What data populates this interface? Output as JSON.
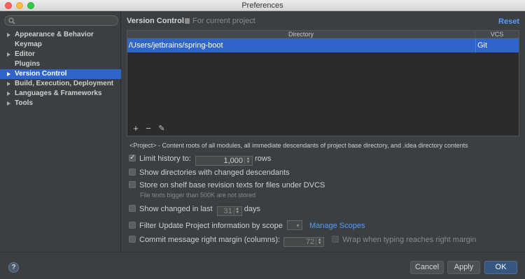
{
  "window": {
    "title": "Preferences"
  },
  "sidebar": {
    "search_placeholder": "",
    "items": [
      {
        "label": "Appearance & Behavior",
        "expandable": true,
        "selected": false
      },
      {
        "label": "Keymap",
        "expandable": false,
        "selected": false
      },
      {
        "label": "Editor",
        "expandable": true,
        "selected": false
      },
      {
        "label": "Plugins",
        "expandable": false,
        "selected": false
      },
      {
        "label": "Version Control",
        "expandable": true,
        "selected": true
      },
      {
        "label": "Build, Execution, Deployment",
        "expandable": true,
        "selected": false
      },
      {
        "label": "Languages & Frameworks",
        "expandable": true,
        "selected": false
      },
      {
        "label": "Tools",
        "expandable": true,
        "selected": false
      }
    ]
  },
  "main": {
    "heading": "Version Control",
    "scope": "For current project",
    "reset_label": "Reset",
    "table": {
      "columns": [
        "Directory",
        "VCS"
      ],
      "rows": [
        {
          "directory": "/Users/jetbrains/spring-boot",
          "vcs": "Git"
        }
      ]
    },
    "toolbar": {
      "add": "+",
      "remove": "−",
      "edit": "✎"
    },
    "description": "<Project> - Content roots of all modules, all immediate descendants of project base directory, and .idea directory contents",
    "options": {
      "limit_history": {
        "label": "Limit history to:",
        "checked": true,
        "value": "1,000",
        "suffix": "rows"
      },
      "show_dirs": {
        "label": "Show directories with changed descendants",
        "checked": false
      },
      "store_shelf": {
        "label": "Store on shelf base revision texts for files under DVCS",
        "checked": false,
        "hint": "File texts bigger than 500K are not stored"
      },
      "show_changed": {
        "label": "Show changed in last",
        "checked": false,
        "value": "31",
        "suffix": "days"
      },
      "filter_update": {
        "label": "Filter Update Project information by scope",
        "checked": false,
        "link": "Manage Scopes"
      },
      "commit_margin": {
        "label": "Commit message right margin (columns):",
        "checked": false,
        "value": "72",
        "wrap_label": "Wrap when typing reaches right margin",
        "wrap_checked": false
      }
    }
  },
  "footer": {
    "help": "?",
    "cancel": "Cancel",
    "apply": "Apply",
    "ok": "OK"
  },
  "colors": {
    "accent": "#2f65ca",
    "link": "#589df6",
    "background": "#3c3f41",
    "table_bg": "#2b2b2b"
  }
}
